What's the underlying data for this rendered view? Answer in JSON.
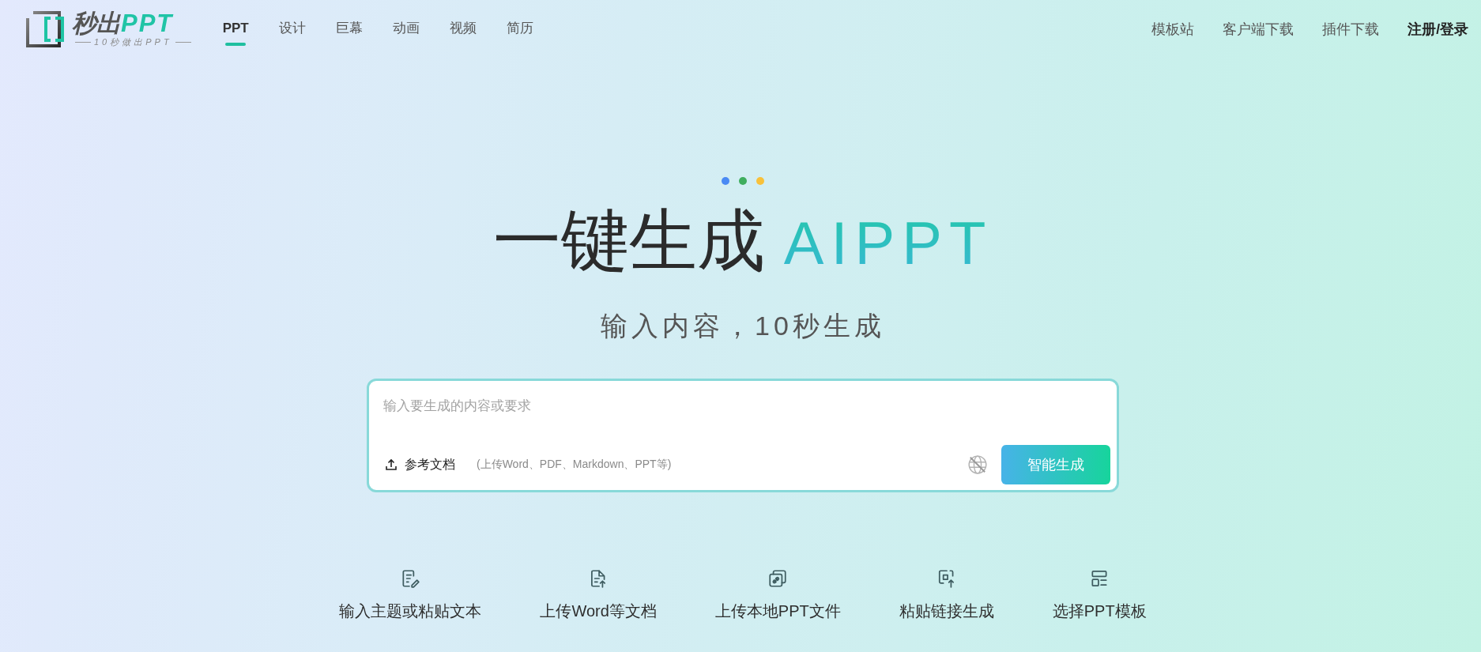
{
  "logo": {
    "title_main": "秒出",
    "title_accent": "PPT",
    "tagline": "10秒做出PPT"
  },
  "nav": [
    {
      "label": "PPT",
      "selected": true
    },
    {
      "label": "设计",
      "selected": false
    },
    {
      "label": "巨幕",
      "selected": false
    },
    {
      "label": "动画",
      "selected": false
    },
    {
      "label": "视频",
      "selected": false
    },
    {
      "label": "简历",
      "selected": false
    }
  ],
  "links": [
    {
      "label": "模板站",
      "kind": "link"
    },
    {
      "label": "客户端下载",
      "kind": "link"
    },
    {
      "label": "插件下载",
      "kind": "link"
    },
    {
      "label": "注册/登录",
      "kind": "account"
    }
  ],
  "hero": {
    "dots": [
      {
        "color": "#4a8af4"
      },
      {
        "color": "#3fae5e"
      },
      {
        "color": "#f8c13a"
      }
    ],
    "title": "一键生成",
    "title_accent": "AIPPT",
    "subtitle": "输入内容，10秒生成"
  },
  "prompt": {
    "placeholder": "输入要生成的内容或要求",
    "attach_label": "参考文档",
    "attach_hint": "(上传Word、PDF、Markdown、PPT等)",
    "web_search": false,
    "submit": "智能生成"
  },
  "features": [
    {
      "label": "输入主题或粘贴文本",
      "kind": "text"
    },
    {
      "label": "上传Word等文档",
      "kind": "doc"
    },
    {
      "label": "上传本地PPT文件",
      "kind": "ppt"
    },
    {
      "label": "粘贴链接生成",
      "kind": "link"
    },
    {
      "label": "选择PPT模板",
      "kind": "template"
    }
  ]
}
